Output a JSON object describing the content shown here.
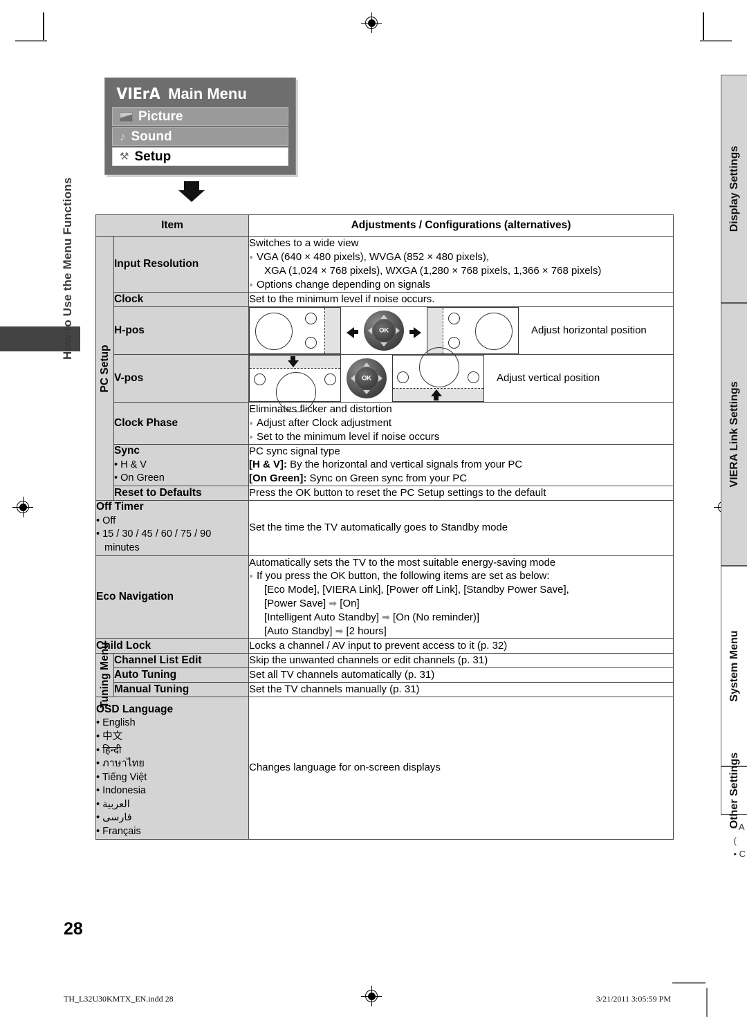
{
  "page": {
    "number": "28",
    "left_chapter_tab": "How to Use the Menu Functions"
  },
  "right_tabs": [
    {
      "label": "Display Settings"
    },
    {
      "label": "VIERA Link Settings"
    },
    {
      "label": "System Menu"
    },
    {
      "label": "Other Settings"
    }
  ],
  "viera_menu": {
    "logo": "VIErA",
    "title": "Main Menu",
    "items": [
      {
        "label": "Picture",
        "icon": "picture-icon",
        "selected": false
      },
      {
        "label": "Sound",
        "icon": "music-note-icon",
        "selected": false
      },
      {
        "label": "Setup",
        "icon": "setup-wrench-icon",
        "selected": true
      }
    ]
  },
  "table": {
    "headers": {
      "item": "Item",
      "adjustments": "Adjustments / Configurations (alternatives)"
    },
    "groups": {
      "pc_setup": "PC Setup",
      "tuning_menu": "Tuning Menu"
    },
    "rows": {
      "input_resolution": {
        "label": "Input Resolution",
        "line1": "Switches to a wide view",
        "bullet1_a": "VGA (640 × 480 pixels), WVGA (852 × 480 pixels),",
        "bullet1_b": "XGA (1,024 × 768 pixels), WXGA (1,280 × 768 pixels, 1,366 × 768 pixels)",
        "bullet2": "Options change depending on signals"
      },
      "clock": {
        "label": "Clock",
        "desc": "Set to the minimum level if noise occurs."
      },
      "h_pos": {
        "label": "H-pos",
        "desc": "Adjust horizontal position"
      },
      "v_pos": {
        "label": "V-pos",
        "desc": "Adjust vertical position"
      },
      "clock_phase": {
        "label": "Clock Phase",
        "line1": "Eliminates flicker and distortion",
        "bullet1": "Adjust after Clock adjustment",
        "bullet2": "Set to the minimum level if noise occurs"
      },
      "sync": {
        "label": "Sync",
        "option1": "H & V",
        "option2": "On Green",
        "line1": "PC sync signal type",
        "line2_bold": "[H & V]:",
        "line2_rest": " By the horizontal and vertical signals from your PC",
        "line3_bold": "[On Green]:",
        "line3_rest": " Sync on Green sync from your PC"
      },
      "reset_to_defaults": {
        "label": "Reset to Defaults",
        "desc": "Press the OK button to reset the PC Setup settings to the default"
      },
      "off_timer": {
        "label": "Off Timer",
        "option1": "Off",
        "option2_a": "15 / 30 / 45 / 60 / 75 / 90",
        "option2_b": "minutes",
        "desc": "Set the time the TV automatically goes to Standby mode"
      },
      "eco_navigation": {
        "label": "Eco Navigation",
        "line1": "Automatically sets the TV to the most suitable energy-saving mode",
        "bullet1": "If you press the OK button, the following items are set as below:",
        "sub1": "[Eco Mode], [VIERA Link], [Power off Link], [Standby Power Save],",
        "sub2_a": "[Power Save]",
        "sub2_b": "[On]",
        "sub3_a": "[Intelligent Auto Standby]",
        "sub3_b": "[On (No reminder)]",
        "sub4_a": "[Auto Standby]",
        "sub4_b": "[2 hours]",
        "arrow": "➡"
      },
      "child_lock": {
        "label": "Child Lock",
        "desc": "Locks a channel / AV input to prevent access to it (p. 32)"
      },
      "channel_list_edit": {
        "label": "Channel List Edit",
        "desc": "Skip the unwanted channels or edit channels (p. 31)"
      },
      "auto_tuning": {
        "label": "Auto Tuning",
        "desc": "Set all TV channels automatically (p. 31)"
      },
      "manual_tuning": {
        "label": "Manual Tuning",
        "desc": "Set the TV channels manually (p. 31)"
      },
      "osd_language": {
        "label": "OSD Language",
        "options": [
          "English",
          "中文",
          "हिन्दी",
          "ภาษาไทย",
          "Tiếng Việt",
          "Indonesia",
          "العربية",
          "فارسی",
          "Français"
        ],
        "desc": "Changes language for on-screen displays"
      }
    }
  },
  "footer": {
    "file": "TH_L32U30KMTX_EN.indd   28",
    "timestamp": "3/21/2011   3:05:59 PM"
  }
}
